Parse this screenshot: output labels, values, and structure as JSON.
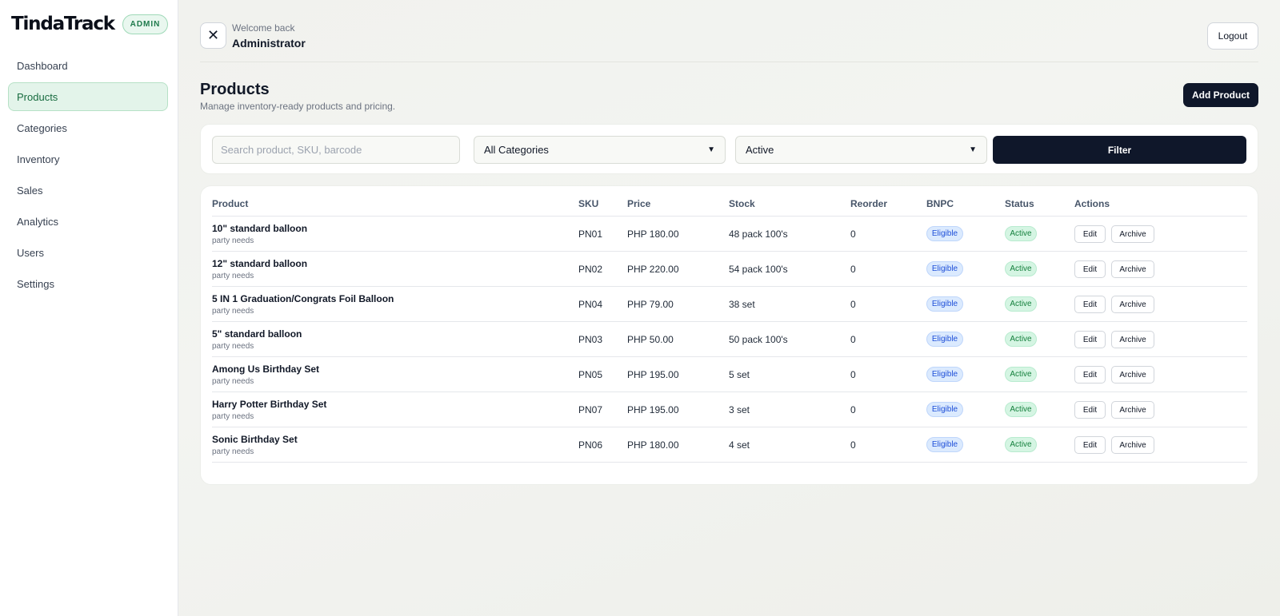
{
  "sidebar": {
    "logo": "TindaTrack",
    "badge": "ADMIN",
    "items": [
      {
        "label": "Dashboard"
      },
      {
        "label": "Products"
      },
      {
        "label": "Categories"
      },
      {
        "label": "Inventory"
      },
      {
        "label": "Sales"
      },
      {
        "label": "Analytics"
      },
      {
        "label": "Users"
      },
      {
        "label": "Settings"
      }
    ],
    "active": "Products"
  },
  "topbar": {
    "close_icon": "✕",
    "welcome_small": "Welcome back",
    "welcome_name": "Administrator",
    "logout_label": "Logout"
  },
  "page": {
    "title": "Products",
    "subtitle": "Manage inventory-ready products and pricing.",
    "add_label": "Add Product"
  },
  "filters": {
    "search_placeholder": "Search product, SKU, barcode",
    "category_value": "All Categories",
    "status_value": "Active",
    "filter_label": "Filter"
  },
  "table": {
    "headers": {
      "product": "Product",
      "sku": "SKU",
      "price": "Price",
      "stock": "Stock",
      "reorder": "Reorder",
      "bnpc": "BNPC",
      "status": "Status",
      "actions": "Actions"
    },
    "edit_label": "Edit",
    "archive_label": "Archive",
    "rows": [
      {
        "name": "10\" standard balloon",
        "category": "party needs",
        "sku": "PN01",
        "price": "PHP 180.00",
        "stock": "48 pack 100's",
        "reorder": "0",
        "bnpc": "Eligible",
        "status": "Active"
      },
      {
        "name": "12\" standard balloon",
        "category": "party needs",
        "sku": "PN02",
        "price": "PHP 220.00",
        "stock": "54 pack 100's",
        "reorder": "0",
        "bnpc": "Eligible",
        "status": "Active"
      },
      {
        "name": "5 IN 1 Graduation/Congrats Foil Balloon",
        "category": "party needs",
        "sku": "PN04",
        "price": "PHP 79.00",
        "stock": "38 set",
        "reorder": "0",
        "bnpc": "Eligible",
        "status": "Active"
      },
      {
        "name": "5\" standard balloon",
        "category": "party needs",
        "sku": "PN03",
        "price": "PHP 50.00",
        "stock": "50 pack 100's",
        "reorder": "0",
        "bnpc": "Eligible",
        "status": "Active"
      },
      {
        "name": "Among Us Birthday Set",
        "category": "party needs",
        "sku": "PN05",
        "price": "PHP 195.00",
        "stock": "5 set",
        "reorder": "0",
        "bnpc": "Eligible",
        "status": "Active"
      },
      {
        "name": "Harry Potter Birthday Set",
        "category": "party needs",
        "sku": "PN07",
        "price": "PHP 195.00",
        "stock": "3 set",
        "reorder": "0",
        "bnpc": "Eligible",
        "status": "Active"
      },
      {
        "name": "Sonic Birthday Set",
        "category": "party needs",
        "sku": "PN06",
        "price": "PHP 180.00",
        "stock": "4 set",
        "reorder": "0",
        "bnpc": "Eligible",
        "status": "Active"
      }
    ]
  }
}
